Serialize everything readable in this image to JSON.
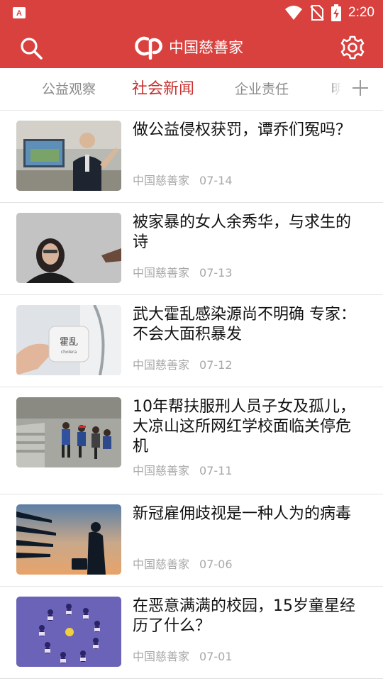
{
  "status_bar": {
    "time": "2:20",
    "icons": [
      "app-notification-icon",
      "wifi-icon",
      "no-sim-icon",
      "battery-charging-icon"
    ]
  },
  "app_bar": {
    "logo_text": "中国慈善家",
    "logo_mark": "cp",
    "search_icon": "search-icon",
    "settings_icon": "gear-icon"
  },
  "tabs": {
    "items": [
      {
        "label": "公益观察",
        "active": false
      },
      {
        "label": "社会新闻",
        "active": true
      },
      {
        "label": "企业责任",
        "active": false
      },
      {
        "label": "明",
        "active": false
      }
    ],
    "add_icon": "plus-icon"
  },
  "colors": {
    "brand_red": "#d9413f",
    "active_tab": "#c8302f",
    "meta_gray": "#a8a8a8"
  },
  "articles": [
    {
      "title": "做公益侵权获罚，谭乔们冤吗？",
      "source": "中国慈善家",
      "date": "07-14"
    },
    {
      "title": "被家暴的女人余秀华，与求生的诗",
      "source": "中国慈善家",
      "date": "07-13"
    },
    {
      "title": "武大霍乱感染源尚不明确 专家：不会大面积暴发",
      "source": "中国慈善家",
      "date": "07-12",
      "thumb_text": "霍乱",
      "thumb_subtext": "cholera"
    },
    {
      "title": "10年帮扶服刑人员子女及孤儿，大凉山这所网红学校面临关停危机",
      "source": "中国慈善家",
      "date": "07-11"
    },
    {
      "title": "新冠雇佣歧视是一种人为的病毒",
      "source": "中国慈善家",
      "date": "07-06"
    },
    {
      "title": "在恶意满满的校园，15岁童星经历了什么？",
      "source": "中国慈善家",
      "date": "07-01"
    }
  ]
}
